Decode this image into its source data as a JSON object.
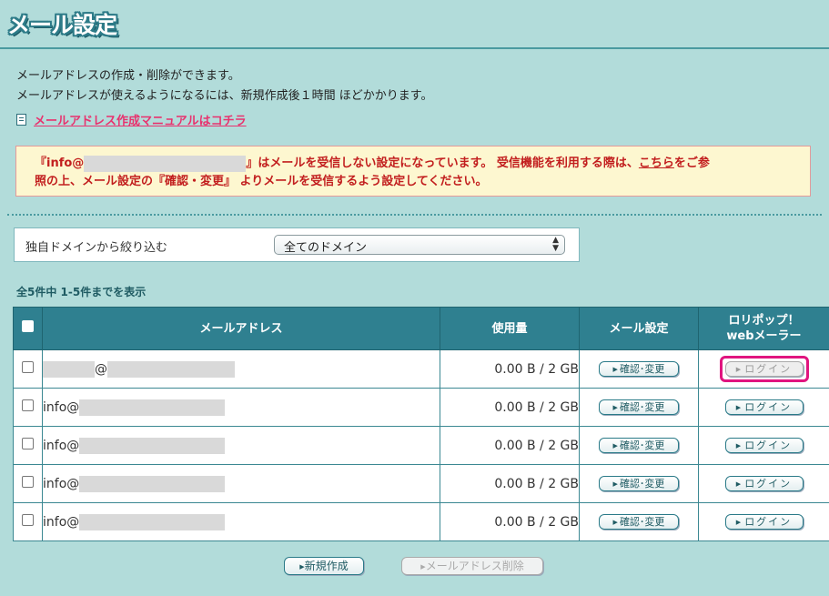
{
  "page": {
    "title": "メール設定",
    "description_line1": "メールアドレスの作成・削除ができます。",
    "description_line2": "メールアドレスが使えるようになるには、新規作成後１時間 ほどかかります。",
    "manual_link": "メールアドレス作成マニュアルはコチラ"
  },
  "warning": {
    "prefix": "『info@",
    "suffix": "』はメールを受信しない設定になっています。 受信機能を利用する際は、",
    "link": "こちら",
    "after_link": "をご参",
    "line2": "照の上、メール設定の『確認・変更』 よりメールを受信するよう設定してください。"
  },
  "filter": {
    "label": "独自ドメインから絞り込む",
    "selected": "全てのドメイン"
  },
  "count_text": "全5件中 1-5件までを表示",
  "table": {
    "headers": {
      "address": "メールアドレス",
      "usage": "使用量",
      "settings": "メール設定",
      "webmailer_line1": "ロリポップ！",
      "webmailer_line2": "webメーラー"
    },
    "rows": [
      {
        "address_prefix": "",
        "address_at": "@",
        "usage": "0.00 B / 2 GB",
        "confirm": "確認･変更",
        "login": "ログイン"
      },
      {
        "address_prefix": "info@",
        "address_at": "",
        "usage": "0.00 B / 2 GB",
        "confirm": "確認･変更",
        "login": "ログイン"
      },
      {
        "address_prefix": "info@",
        "address_at": "",
        "usage": "0.00 B / 2 GB",
        "confirm": "確認･変更",
        "login": "ログイン"
      },
      {
        "address_prefix": "info@",
        "address_at": "",
        "usage": "0.00 B / 2 GB",
        "confirm": "確認･変更",
        "login": "ログイン"
      },
      {
        "address_prefix": "info@",
        "address_at": "",
        "usage": "0.00 B / 2 GB",
        "confirm": "確認･変更",
        "login": "ログイン"
      }
    ]
  },
  "actions": {
    "new": "新規作成",
    "delete": "メールアドレス削除"
  },
  "colors": {
    "background": "#b2dcda",
    "header": "#2f8090",
    "warning_text": "#c21e1e",
    "link": "#e8326e",
    "highlight": "#e0157f"
  }
}
